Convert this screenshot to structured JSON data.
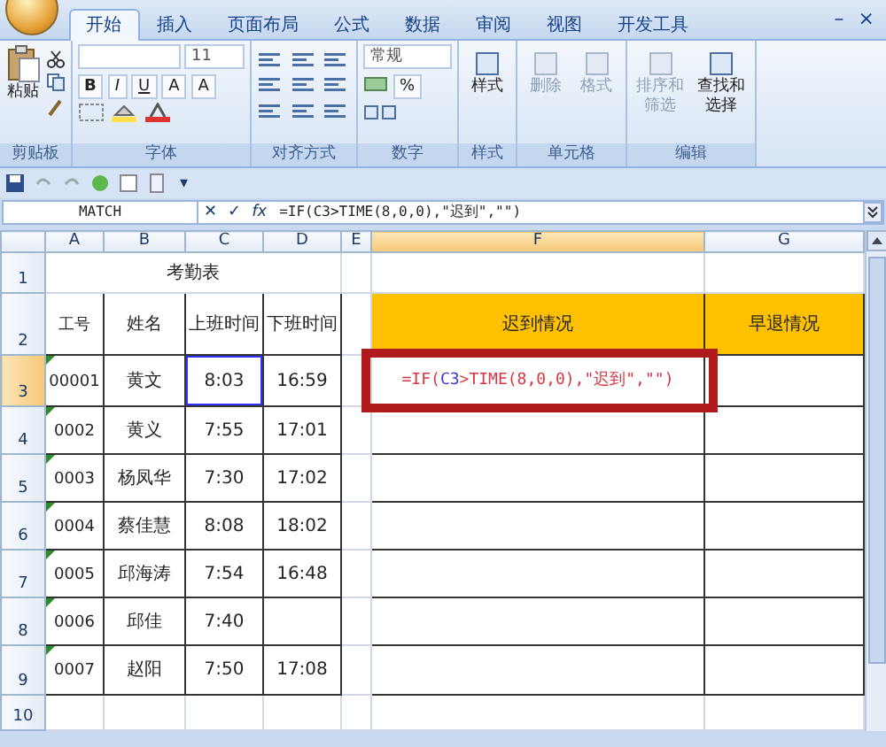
{
  "tabs": [
    {
      "label": "开始",
      "selected": true
    },
    {
      "label": "插入",
      "selected": false
    },
    {
      "label": "页面布局",
      "selected": false
    },
    {
      "label": "公式",
      "selected": false
    },
    {
      "label": "数据",
      "selected": false
    },
    {
      "label": "审阅",
      "selected": false
    },
    {
      "label": "视图",
      "selected": false
    },
    {
      "label": "开发工具",
      "selected": false
    }
  ],
  "window_controls": [
    "–",
    "×"
  ],
  "ribbon_groups": [
    {
      "kind": "clipboard",
      "label": "剪贴板",
      "buttons": [
        {
          "label": "粘贴",
          "disabled": false
        }
      ]
    },
    {
      "kind": "font",
      "label": "字体",
      "font_size": "11",
      "font_buttons": [
        "B",
        "I",
        "U",
        "A",
        "A"
      ]
    },
    {
      "kind": "align",
      "label": "对齐方式"
    },
    {
      "kind": "number",
      "label": "数字",
      "number_format": "常规",
      "symbols": [
        "%"
      ]
    },
    {
      "kind": "styles",
      "label": "样式",
      "buttons": [
        {
          "label": "样式",
          "disabled": false
        }
      ]
    },
    {
      "kind": "cells",
      "label": "单元格",
      "buttons": [
        {
          "label": "删除",
          "disabled": true
        },
        {
          "label": "格式",
          "disabled": true
        }
      ]
    },
    {
      "kind": "editing",
      "label": "编辑",
      "buttons": [
        {
          "label": "排序和筛选",
          "disabled": true
        },
        {
          "label": "查找和选择",
          "disabled": false
        }
      ]
    }
  ],
  "quick_access_menu": "▾",
  "formula_bar": {
    "name_box": "MATCH",
    "buttons": [
      "✕",
      "✓",
      "fx"
    ],
    "formula": "=IF(C3>TIME(8,0,0),\"迟到\",\"\")"
  },
  "columns": [
    {
      "label": "A",
      "selected": false
    },
    {
      "label": "B",
      "selected": false
    },
    {
      "label": "C",
      "selected": false
    },
    {
      "label": "D",
      "selected": false
    },
    {
      "label": "E",
      "selected": false
    },
    {
      "label": "F",
      "selected": true
    },
    {
      "label": "G",
      "selected": false
    }
  ],
  "rows": [
    {
      "label": "1",
      "selected": false,
      "cells": [
        {
          "kind": "title",
          "text": "考勤表"
        },
        {
          "kind": "plain"
        },
        {
          "kind": "plain"
        },
        {
          "kind": "plain"
        }
      ]
    },
    {
      "label": "2",
      "selected": false,
      "cells": [
        {
          "kind": "box",
          "text": "工号"
        },
        {
          "kind": "box",
          "text": "姓名"
        },
        {
          "kind": "box",
          "text": "上班时间"
        },
        {
          "kind": "box",
          "text": "下班时间"
        },
        {
          "kind": "plain"
        },
        {
          "kind": "header",
          "text": "迟到情况"
        },
        {
          "kind": "header",
          "text": "早退情况"
        }
      ]
    },
    {
      "label": "3",
      "selected": true,
      "cells": [
        {
          "kind": "box",
          "text": "00001",
          "flag": true
        },
        {
          "kind": "box",
          "text": "黄文"
        },
        {
          "kind": "box",
          "text": "8:03",
          "referenced": true
        },
        {
          "kind": "box",
          "text": "16:59"
        },
        {
          "kind": "plain"
        },
        {
          "kind": "box",
          "highlighted": true,
          "formula": [
            {
              "text": "=IF(",
              "color": "#d9343f"
            },
            {
              "text": "C3",
              "color": "#3a3ad6"
            },
            {
              "text": ">TIME(8,0,0),\"迟到\",\"\")",
              "color": "#d9343f"
            }
          ]
        },
        {
          "kind": "box"
        }
      ]
    },
    {
      "label": "4",
      "selected": false,
      "cells": [
        {
          "kind": "box",
          "text": "0002",
          "flag": true
        },
        {
          "kind": "box",
          "text": "黄义"
        },
        {
          "kind": "box",
          "text": "7:55"
        },
        {
          "kind": "box",
          "text": "17:01"
        },
        {
          "kind": "plain"
        },
        {
          "kind": "box"
        },
        {
          "kind": "box"
        }
      ]
    },
    {
      "label": "5",
      "selected": false,
      "cells": [
        {
          "kind": "box",
          "text": "0003",
          "flag": true
        },
        {
          "kind": "box",
          "text": "杨凤华"
        },
        {
          "kind": "box",
          "text": "7:30"
        },
        {
          "kind": "box",
          "text": "17:02"
        },
        {
          "kind": "plain"
        },
        {
          "kind": "box"
        },
        {
          "kind": "box"
        }
      ]
    },
    {
      "label": "6",
      "selected": false,
      "cells": [
        {
          "kind": "box",
          "text": "0004",
          "flag": true
        },
        {
          "kind": "box",
          "text": "蔡佳慧"
        },
        {
          "kind": "box",
          "text": "8:08"
        },
        {
          "kind": "box",
          "text": "18:02"
        },
        {
          "kind": "plain"
        },
        {
          "kind": "box"
        },
        {
          "kind": "box"
        }
      ]
    },
    {
      "label": "7",
      "selected": false,
      "cells": [
        {
          "kind": "box",
          "text": "0005",
          "flag": true
        },
        {
          "kind": "box",
          "text": "邱海涛"
        },
        {
          "kind": "box",
          "text": "7:54"
        },
        {
          "kind": "box",
          "text": "16:48"
        },
        {
          "kind": "plain"
        },
        {
          "kind": "box"
        },
        {
          "kind": "box"
        }
      ]
    },
    {
      "label": "8",
      "selected": false,
      "cells": [
        {
          "kind": "box",
          "text": "0006",
          "flag": true
        },
        {
          "kind": "box",
          "text": "邱佳"
        },
        {
          "kind": "box",
          "text": "7:40"
        },
        {
          "kind": "box"
        },
        {
          "kind": "plain"
        },
        {
          "kind": "box"
        },
        {
          "kind": "box"
        }
      ]
    },
    {
      "label": "9",
      "selected": false,
      "cells": [
        {
          "kind": "box",
          "text": "0007",
          "flag": true
        },
        {
          "kind": "box",
          "text": "赵阳"
        },
        {
          "kind": "box",
          "text": "7:50"
        },
        {
          "kind": "box",
          "text": "17:08"
        },
        {
          "kind": "plain"
        },
        {
          "kind": "box"
        },
        {
          "kind": "box"
        }
      ]
    },
    {
      "label": "10",
      "selected": false,
      "cells": [
        {
          "kind": "plain"
        },
        {
          "kind": "plain"
        },
        {
          "kind": "plain"
        },
        {
          "kind": "plain"
        },
        {
          "kind": "plain"
        },
        {
          "kind": "plain"
        },
        {
          "kind": "plain"
        }
      ]
    }
  ]
}
